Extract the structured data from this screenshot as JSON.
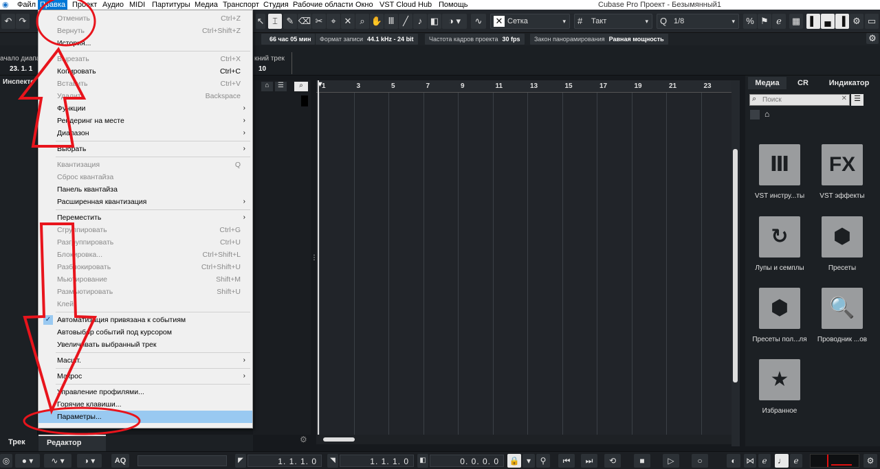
{
  "window": {
    "title": "Cubase Pro Проект - Безымянный1"
  },
  "menubar": {
    "items": [
      {
        "label": "Файл"
      },
      {
        "label": "Правка"
      },
      {
        "label": "Проект"
      },
      {
        "label": "Аудио"
      },
      {
        "label": "MIDI"
      },
      {
        "label": "Партитуры"
      },
      {
        "label": "Медиа"
      },
      {
        "label": "Транспорт"
      },
      {
        "label": "Студия"
      },
      {
        "label": "Рабочие области"
      },
      {
        "label": "Окно"
      },
      {
        "label": "VST Cloud"
      },
      {
        "label": "Hub"
      },
      {
        "label": "Помощь"
      }
    ],
    "active": "Правка"
  },
  "toolbar": {
    "snap_mode": "Сетка",
    "snap_type": "Такт",
    "quantize": "1/8"
  },
  "infobar": {
    "duration": "66 час 05 мин",
    "rec_format_label": "Формат записи",
    "rec_format_value": "44.1 kHz - 24 bit",
    "fps_label": "Частота кадров проекта",
    "fps_value": "30 fps",
    "pan_law_label": "Закон панорамирования",
    "pan_law_value": "Равная мощность"
  },
  "stripbar": {
    "range_start_label": "ачало диапаз",
    "range_start_value": "23. 1. 1",
    "track_label": "кний трек",
    "track_value": "10"
  },
  "left_panel": {
    "inspector_label": "Инспекто"
  },
  "ruler": {
    "bars": [
      "1",
      "3",
      "5",
      "7",
      "9",
      "11",
      "13",
      "15",
      "17",
      "19",
      "21",
      "23"
    ]
  },
  "right_panel": {
    "tabs": [
      {
        "label": "Медиа"
      },
      {
        "label": "CR"
      },
      {
        "label": "Индикатор"
      }
    ],
    "search_placeholder": "Поиск",
    "tiles": [
      {
        "label": "VST инстру...ты",
        "icon": "piano-keys-icon",
        "glyph": "Ⅲ"
      },
      {
        "label": "VST эффекты",
        "icon": "fx-icon",
        "glyph": "FX"
      },
      {
        "label": "Лупы и семплы",
        "icon": "loop-icon",
        "glyph": "↻"
      },
      {
        "label": "Пресеты",
        "icon": "presets-hexagon-icon",
        "glyph": "⬢"
      },
      {
        "label": "Пресеты пол...ля",
        "icon": "user-presets-icon",
        "glyph": "⬢"
      },
      {
        "label": "Проводник ...ов",
        "icon": "browser-search-icon",
        "glyph": "🔍"
      },
      {
        "label": "Избранное",
        "icon": "star-icon",
        "glyph": "★"
      }
    ]
  },
  "zone_tabs": {
    "track": "Трек",
    "editor": "Редактор"
  },
  "bottombar": {
    "aq": "AQ",
    "left_locator": "1. 1. 1.   0",
    "right_locator": "1. 1. 1.   0",
    "position": "0. 0. 0.   0"
  },
  "edit_menu": {
    "items": [
      {
        "label": "Отменить",
        "shortcut": "Ctrl+Z",
        "disabled": true
      },
      {
        "label": "Вернуть",
        "shortcut": "Ctrl+Shift+Z",
        "disabled": true
      },
      {
        "label": "История...",
        "shortcut": "",
        "disabled": false
      },
      {
        "sep": true
      },
      {
        "label": "Вырезать",
        "shortcut": "Ctrl+X",
        "disabled": true
      },
      {
        "label": "Копировать",
        "shortcut": "Ctrl+C",
        "disabled": false
      },
      {
        "label": "Вставить",
        "shortcut": "Ctrl+V",
        "disabled": true
      },
      {
        "label": "Удалить",
        "shortcut": "Backspace",
        "disabled": true
      },
      {
        "label": "Функции",
        "submenu": true
      },
      {
        "label": "Рендеринг на месте",
        "submenu": true
      },
      {
        "label": "Диапазон",
        "submenu": true
      },
      {
        "sep": true
      },
      {
        "label": "Выбрать",
        "submenu": true
      },
      {
        "sep": true
      },
      {
        "label": "Квантизация",
        "shortcut": "Q",
        "disabled": true
      },
      {
        "label": "Сброс квантайза",
        "shortcut": "",
        "disabled": true
      },
      {
        "label": "Панель квантайза",
        "shortcut": "",
        "disabled": false
      },
      {
        "label": "Расширенная квантизация",
        "submenu": true
      },
      {
        "sep": true
      },
      {
        "label": "Переместить",
        "submenu": true
      },
      {
        "label": "Сгруппировать",
        "shortcut": "Ctrl+G",
        "disabled": true
      },
      {
        "label": "Разгруппировать",
        "shortcut": "Ctrl+U",
        "disabled": true
      },
      {
        "label": "Блокировка...",
        "shortcut": "Ctrl+Shift+L",
        "disabled": true
      },
      {
        "label": "Разблокировать",
        "shortcut": "Ctrl+Shift+U",
        "disabled": true
      },
      {
        "label": "Мьютирование",
        "shortcut": "Shift+M",
        "disabled": true
      },
      {
        "label": "Размьютировать",
        "shortcut": "Shift+U",
        "disabled": true
      },
      {
        "label": "Клей",
        "shortcut": "",
        "disabled": true
      },
      {
        "sep": true
      },
      {
        "label": "Автоматизация привязана к событиям",
        "checked": true
      },
      {
        "label": "Автовыбор событий под курсором",
        "shortcut": ""
      },
      {
        "label": "Увеличивать выбранный трек",
        "shortcut": ""
      },
      {
        "sep": true
      },
      {
        "label": "Масшт.",
        "submenu": true
      },
      {
        "sep": true
      },
      {
        "label": "Макрос",
        "submenu": true
      },
      {
        "sep": true
      },
      {
        "label": "Управление профилями...",
        "shortcut": ""
      },
      {
        "label": "Горячие клавиши...",
        "shortcut": ""
      },
      {
        "label": "Параметры...",
        "shortcut": "",
        "highlighted": true
      }
    ]
  },
  "colors": {
    "annotation": "#e8141c",
    "menu_highlight": "#99c9f1",
    "accent_blue": "#0078d7",
    "cursor_red": "#e01010"
  }
}
